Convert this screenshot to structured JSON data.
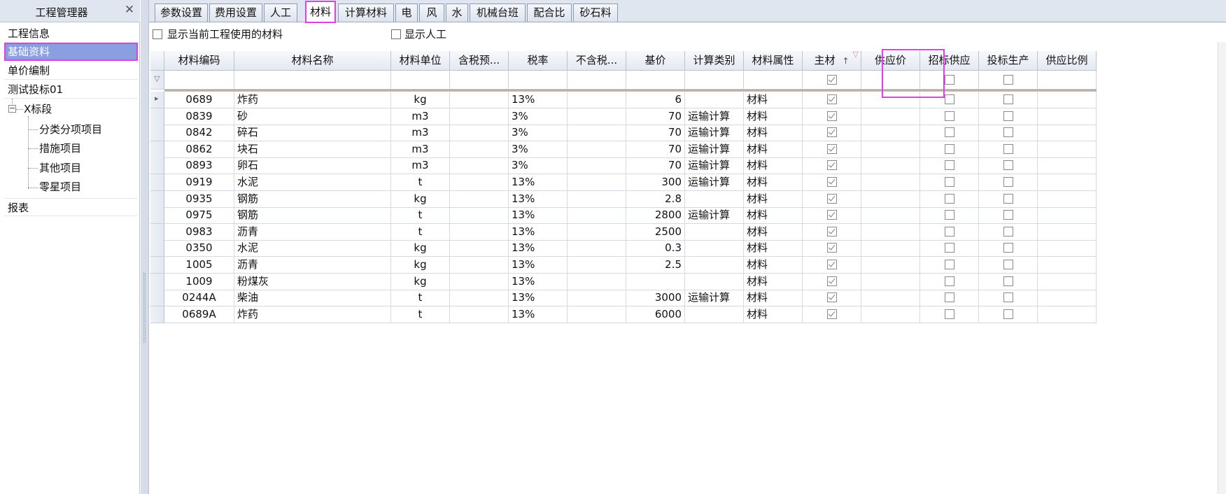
{
  "left_panel": {
    "title": "工程管理器",
    "items": {
      "project_info": "工程信息",
      "base_data": "基础资料",
      "unit_price": "单价编制",
      "test_bid": "测试投标01",
      "section": "X标段",
      "sub_items": "分类分项项目",
      "measures": "措施项目",
      "other": "其他项目",
      "misc": "零星项目",
      "report": "报表"
    },
    "expander_symbol": "−"
  },
  "tabs": [
    "参数设置",
    "费用设置",
    "人工",
    "材料",
    "计算材料",
    "电",
    "风",
    "水",
    "机械台班",
    "配合比",
    "砂石料"
  ],
  "active_tab": "材料",
  "options": {
    "show_current_materials": "显示当前工程使用的材料",
    "show_labor": "显示人工"
  },
  "grid": {
    "columns": [
      "材料编码",
      "材料名称",
      "材料单位",
      "含税预...",
      "税率",
      "不含税...",
      "基价",
      "计算类别",
      "材料属性",
      "主材",
      "供应价",
      "招标供应",
      "投标生产",
      "供应比例"
    ],
    "sort_indicator": "↑",
    "filter_indicator": "▽",
    "filter_row": {
      "main_material_checked": true
    },
    "rows": [
      {
        "code": "0689",
        "name": "炸药",
        "unit": "kg",
        "tax_price": "",
        "tax_rate": "13%",
        "no_tax": "",
        "base_price": "6",
        "calc_type": "",
        "attr": "材料",
        "main": true,
        "supply_price": "",
        "tender_supply": false,
        "bid_production": false,
        "ratio": ""
      },
      {
        "code": "0839",
        "name": "砂",
        "unit": "m3",
        "tax_price": "",
        "tax_rate": "3%",
        "no_tax": "",
        "base_price": "70",
        "calc_type": "运输计算",
        "attr": "材料",
        "main": true,
        "supply_price": "",
        "tender_supply": false,
        "bid_production": false,
        "ratio": ""
      },
      {
        "code": "0842",
        "name": "碎石",
        "unit": "m3",
        "tax_price": "",
        "tax_rate": "3%",
        "no_tax": "",
        "base_price": "70",
        "calc_type": "运输计算",
        "attr": "材料",
        "main": true,
        "supply_price": "",
        "tender_supply": false,
        "bid_production": false,
        "ratio": ""
      },
      {
        "code": "0862",
        "name": "块石",
        "unit": "m3",
        "tax_price": "",
        "tax_rate": "3%",
        "no_tax": "",
        "base_price": "70",
        "calc_type": "运输计算",
        "attr": "材料",
        "main": true,
        "supply_price": "",
        "tender_supply": false,
        "bid_production": false,
        "ratio": ""
      },
      {
        "code": "0893",
        "name": "卵石",
        "unit": "m3",
        "tax_price": "",
        "tax_rate": "3%",
        "no_tax": "",
        "base_price": "70",
        "calc_type": "运输计算",
        "attr": "材料",
        "main": true,
        "supply_price": "",
        "tender_supply": false,
        "bid_production": false,
        "ratio": ""
      },
      {
        "code": "0919",
        "name": "水泥",
        "unit": "t",
        "tax_price": "",
        "tax_rate": "13%",
        "no_tax": "",
        "base_price": "300",
        "calc_type": "运输计算",
        "attr": "材料",
        "main": true,
        "supply_price": "",
        "tender_supply": false,
        "bid_production": false,
        "ratio": ""
      },
      {
        "code": "0935",
        "name": "钢筋",
        "unit": "kg",
        "tax_price": "",
        "tax_rate": "13%",
        "no_tax": "",
        "base_price": "2.8",
        "calc_type": "",
        "attr": "材料",
        "main": true,
        "supply_price": "",
        "tender_supply": false,
        "bid_production": false,
        "ratio": ""
      },
      {
        "code": "0975",
        "name": "钢筋",
        "unit": "t",
        "tax_price": "",
        "tax_rate": "13%",
        "no_tax": "",
        "base_price": "2800",
        "calc_type": "运输计算",
        "attr": "材料",
        "main": true,
        "supply_price": "",
        "tender_supply": false,
        "bid_production": false,
        "ratio": ""
      },
      {
        "code": "0983",
        "name": "沥青",
        "unit": "t",
        "tax_price": "",
        "tax_rate": "13%",
        "no_tax": "",
        "base_price": "2500",
        "calc_type": "",
        "attr": "材料",
        "main": true,
        "supply_price": "",
        "tender_supply": false,
        "bid_production": false,
        "ratio": ""
      },
      {
        "code": "0350",
        "name": "水泥",
        "unit": "kg",
        "tax_price": "",
        "tax_rate": "13%",
        "no_tax": "",
        "base_price": "0.3",
        "calc_type": "",
        "attr": "材料",
        "main": true,
        "supply_price": "",
        "tender_supply": false,
        "bid_production": false,
        "ratio": ""
      },
      {
        "code": "1005",
        "name": "沥青",
        "unit": "kg",
        "tax_price": "",
        "tax_rate": "13%",
        "no_tax": "",
        "base_price": "2.5",
        "calc_type": "",
        "attr": "材料",
        "main": true,
        "supply_price": "",
        "tender_supply": false,
        "bid_production": false,
        "ratio": ""
      },
      {
        "code": "1009",
        "name": "粉煤灰",
        "unit": "kg",
        "tax_price": "",
        "tax_rate": "13%",
        "no_tax": "",
        "base_price": "",
        "calc_type": "",
        "attr": "材料",
        "main": true,
        "supply_price": "",
        "tender_supply": false,
        "bid_production": false,
        "ratio": ""
      },
      {
        "code": "0244A",
        "name": "柴油",
        "unit": "t",
        "tax_price": "",
        "tax_rate": "13%",
        "no_tax": "",
        "base_price": "3000",
        "calc_type": "运输计算",
        "attr": "材料",
        "main": true,
        "supply_price": "",
        "tender_supply": false,
        "bid_production": false,
        "ratio": ""
      },
      {
        "code": "0689A",
        "name": "炸药",
        "unit": "t",
        "tax_price": "",
        "tax_rate": "13%",
        "no_tax": "",
        "base_price": "6000",
        "calc_type": "",
        "attr": "材料",
        "main": true,
        "supply_price": "",
        "tender_supply": false,
        "bid_production": false,
        "ratio": ""
      }
    ]
  }
}
